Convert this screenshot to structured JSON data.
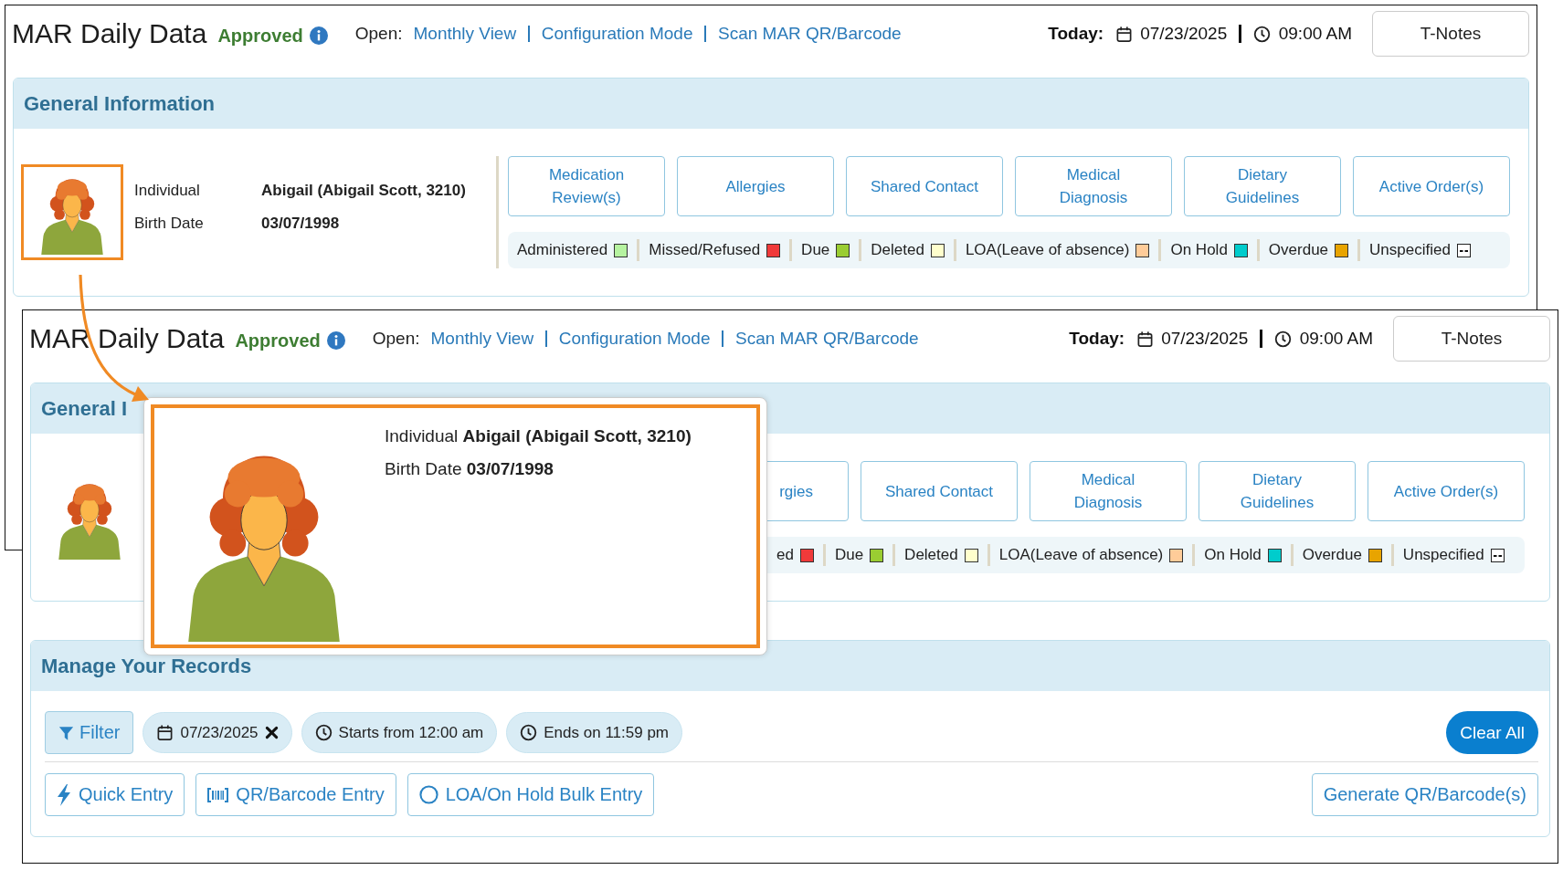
{
  "back_screenshot": {
    "header": {
      "title": "MAR Daily Data",
      "status": "Approved",
      "open_label": "Open:",
      "links": [
        "Monthly View",
        "Configuration Mode",
        "Scan MAR QR/Barcode"
      ],
      "today_label": "Today:",
      "date": "07/23/2025",
      "time": "09:00 AM",
      "notes_button": "T-Notes"
    },
    "general_information": {
      "title": "General Information",
      "avatar_highlighted": true,
      "individual_label": "Individual",
      "individual_value": "Abigail (Abigail Scott, 3210)",
      "birth_label": "Birth Date",
      "birth_value": "03/07/1998",
      "buttons": [
        {
          "label": "Medication Review(s)",
          "kind": "full"
        },
        {
          "label": "Allergies",
          "kind": "full"
        },
        {
          "label": "Shared Contact",
          "kind": "full"
        },
        {
          "label": "Medical Diagnosis",
          "kind": "full"
        },
        {
          "label": "Dietary Guidelines",
          "kind": "full"
        },
        {
          "label": "Active Order(s)",
          "kind": "full"
        }
      ],
      "legend": [
        {
          "label": "Administered",
          "color": "#b6f3a0",
          "kind": "swatch"
        },
        {
          "label": "Missed/Refused",
          "color": "#f03a3a",
          "kind": "swatch"
        },
        {
          "label": "Due",
          "color": "#9acd32",
          "kind": "swatch"
        },
        {
          "label": "Deleted",
          "color": "#ffffcc",
          "kind": "swatch"
        },
        {
          "label": "LOA(Leave of absence)",
          "color": "#ffcc99",
          "kind": "swatch"
        },
        {
          "label": "On Hold",
          "color": "#00cccc",
          "kind": "swatch"
        },
        {
          "label": "Overdue",
          "color": "#e8a400",
          "kind": "swatch"
        },
        {
          "label": "Unspecified",
          "kind": "unspecified"
        }
      ]
    }
  },
  "front_screenshot": {
    "header": {
      "title": "MAR Daily Data",
      "status": "Approved",
      "open_label": "Open:",
      "links": [
        "Monthly View",
        "Configuration Mode",
        "Scan MAR QR/Barcode"
      ],
      "today_label": "Today:",
      "date": "07/23/2025",
      "time": "09:00 AM",
      "notes_button": "T-Notes"
    },
    "general_information": {
      "title": "General I",
      "avatar_highlighted": false,
      "buttons": [
        {
          "label": "rgies",
          "kind": "partial"
        },
        {
          "label": "Shared Contact",
          "kind": "full"
        },
        {
          "label": "Medical Diagnosis",
          "kind": "full"
        },
        {
          "label": "Dietary Guidelines",
          "kind": "full"
        },
        {
          "label": "Active Order(s)",
          "kind": "full"
        }
      ],
      "legend": [
        {
          "label": "ed",
          "color": "#f03a3a",
          "kind": "partial"
        },
        {
          "label": "Due",
          "color": "#9acd32",
          "kind": "swatch"
        },
        {
          "label": "Deleted",
          "color": "#ffffcc",
          "kind": "swatch"
        },
        {
          "label": "LOA(Leave of absence)",
          "color": "#ffcc99",
          "kind": "swatch"
        },
        {
          "label": "On Hold",
          "color": "#00cccc",
          "kind": "swatch"
        },
        {
          "label": "Overdue",
          "color": "#e8a400",
          "kind": "swatch"
        },
        {
          "label": "Unspecified",
          "kind": "unspecified"
        }
      ]
    },
    "popup": {
      "highlighted": true,
      "individual": "Individual **Abigail (Abigail Scott, 3210)**",
      "birth_date": "Birth Date **03/07/1998**"
    },
    "manage_records": {
      "title": "Manage Your Records",
      "filter_button": "Filter",
      "chips": [
        {
          "kind": "date",
          "text": "07/23/2025",
          "removable": true
        },
        {
          "kind": "time",
          "text": "Starts from 12:00 am",
          "removable": false
        },
        {
          "kind": "time",
          "text": "Ends on 11:59 pm",
          "removable": false
        }
      ],
      "clear_all": "Clear All",
      "entry_buttons": [
        {
          "kind": "quick",
          "label": "Quick Entry"
        },
        {
          "kind": "barcode",
          "label": "QR/Barcode Entry"
        },
        {
          "kind": "bulk",
          "label": "LOA/On Hold Bulk Entry"
        }
      ],
      "generate_button": "Generate QR/Barcode(s)"
    }
  }
}
